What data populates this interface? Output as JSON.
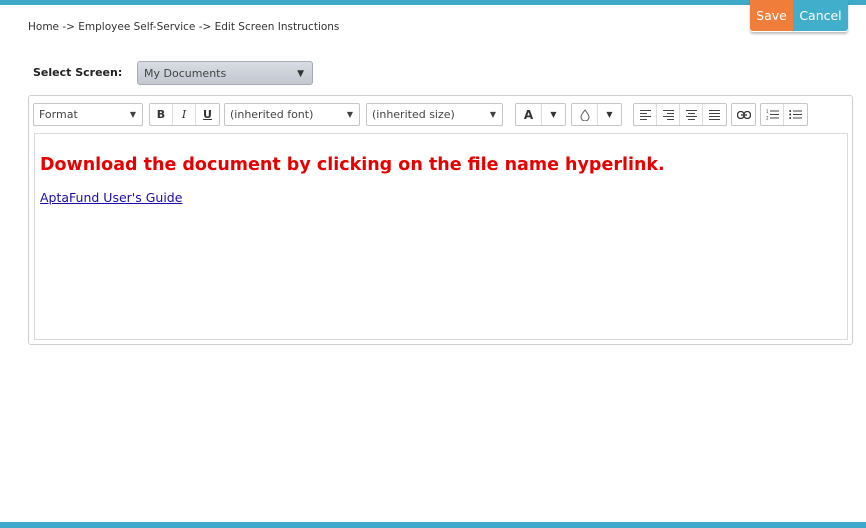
{
  "breadcrumb": {
    "text": "Home -> Employee Self-Service -> Edit Screen Instructions"
  },
  "actions": {
    "save_label": "Save",
    "cancel_label": "Cancel"
  },
  "screen_selector": {
    "label": "Select Screen:",
    "selected": "My Documents"
  },
  "toolbar": {
    "format": "Format",
    "bold": "B",
    "italic": "I",
    "underline": "U",
    "font": "(inherited font)",
    "size": "(inherited size)",
    "text_color": "A",
    "icons": [
      "chevron-down-icon",
      "text-color-icon",
      "background-color-icon",
      "align-left-icon",
      "align-right-icon",
      "align-center-icon",
      "align-justify-icon",
      "link-icon",
      "ordered-list-icon",
      "unordered-list-icon"
    ]
  },
  "content": {
    "heading": "Download the document by clicking on the file name hyperlink.",
    "link": "AptaFund User's Guide"
  },
  "colors": {
    "accent": "#3fa9c9",
    "save": "#f07d3a",
    "cancel": "#41aecb",
    "heading": "#e60000",
    "link": "#1a0dab"
  }
}
